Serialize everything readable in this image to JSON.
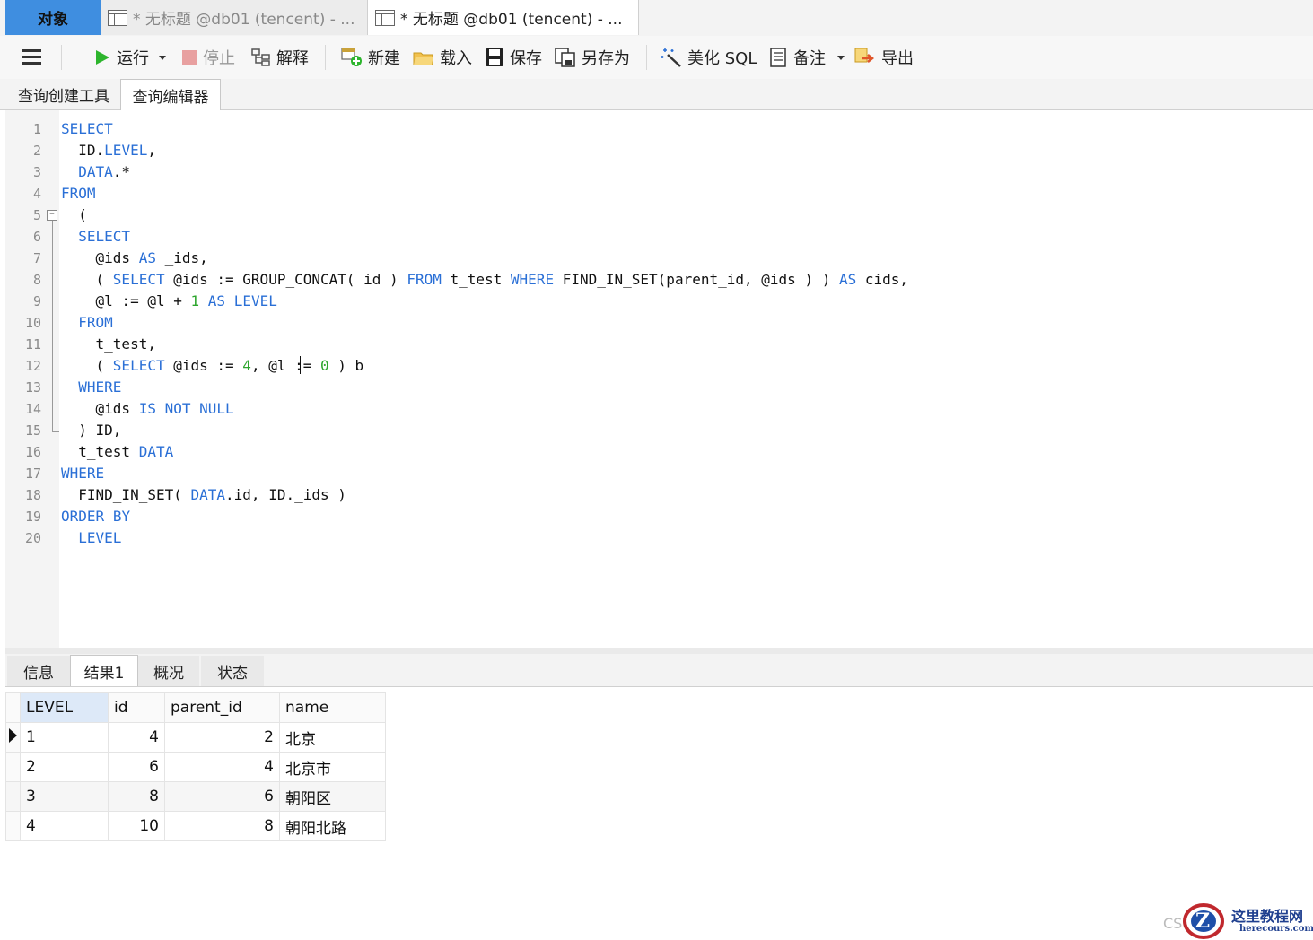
{
  "tabs": {
    "objects": "对象",
    "query1": "* 无标题 @db01 (tencent) - ...",
    "query2": "* 无标题 @db01 (tencent) - ..."
  },
  "toolbar": {
    "run": "运行",
    "stop": "停止",
    "explain": "解释",
    "new": "新建",
    "load": "载入",
    "save": "保存",
    "save_as": "另存为",
    "beautify": "美化 SQL",
    "notes": "备注",
    "export": "导出"
  },
  "subtabs": {
    "builder": "查询创建工具",
    "editor": "查询编辑器"
  },
  "editor": {
    "line_numbers": [
      "1",
      "2",
      "3",
      "4",
      "5",
      "6",
      "7",
      "8",
      "9",
      "10",
      "11",
      "12",
      "13",
      "14",
      "15",
      "16",
      "17",
      "18",
      "19",
      "20"
    ],
    "fold_marker": "−"
  },
  "result_tabs": {
    "info": "信息",
    "result1": "结果1",
    "overview": "概况",
    "status": "状态"
  },
  "grid": {
    "columns": [
      "LEVEL",
      "id",
      "parent_id",
      "name"
    ],
    "rows": [
      {
        "level": "1",
        "id": "4",
        "parent_id": "2",
        "name": "北京"
      },
      {
        "level": "2",
        "id": "6",
        "parent_id": "4",
        "name": "北京市"
      },
      {
        "level": "3",
        "id": "8",
        "parent_id": "6",
        "name": "朝阳区"
      },
      {
        "level": "4",
        "id": "10",
        "parent_id": "8",
        "name": "朝阳北路"
      }
    ]
  },
  "watermark": {
    "prefix": "CS",
    "logo_letter": "Z",
    "site_name": "这里教程网",
    "site_url": "herecours.com"
  },
  "colors": {
    "keyword": "#2a6fd6",
    "number": "#2da52d",
    "active_tab": "#3f8ee0"
  }
}
